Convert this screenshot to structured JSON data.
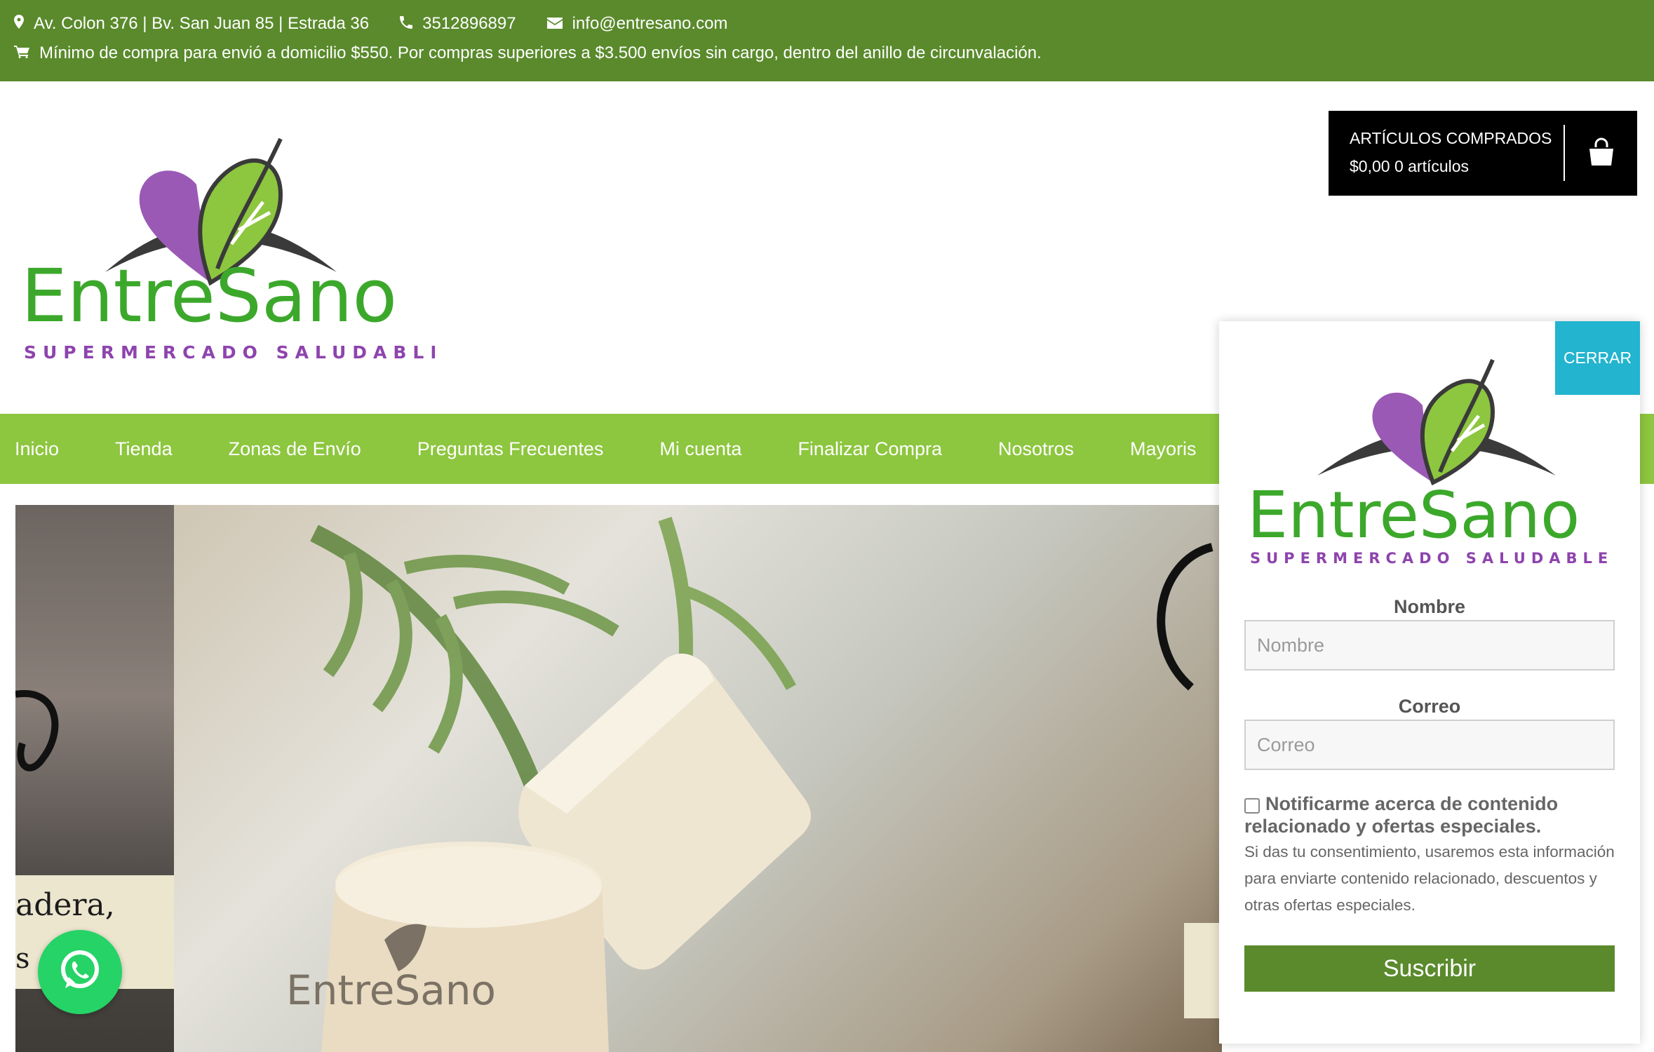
{
  "topbar": {
    "address": "Av. Colon 376 | Bv. San Juan 85 | Estrada 36",
    "phone": "3512896897",
    "email": "info@entresano.com",
    "notice": "Mínimo de compra para envió a domicilio $550. Por compras superiores a $3.500 envíos sin cargo, dentro del anillo de circunvalación."
  },
  "logo": {
    "brand_entre": "Entre",
    "brand_s": "S",
    "brand_ano": "ano",
    "tagline": "SUPERMERCADO SALUDABLE"
  },
  "cart": {
    "title": "ARTÍCULOS COMPRADOS",
    "summary": "$0,00 0 artículos"
  },
  "nav": {
    "items": [
      {
        "label": "Inicio"
      },
      {
        "label": "Tienda"
      },
      {
        "label": "Zonas de Envío"
      },
      {
        "label": "Preguntas Frecuentes"
      },
      {
        "label": "Mi cuenta"
      },
      {
        "label": "Finalizar Compra"
      },
      {
        "label": "Nosotros"
      },
      {
        "label": "Mayoris"
      }
    ]
  },
  "hero": {
    "left_text1": "adera,",
    "left_text2": "s"
  },
  "popup": {
    "close_label": "CERRAR",
    "name_label": "Nombre",
    "name_placeholder": "Nombre",
    "email_label": "Correo",
    "email_placeholder": "Correo",
    "consent_title": "Notificarme acerca de contenido relacionado y ofertas especiales.",
    "consent_text": "Si das tu consentimiento, usaremos esta información para enviarte contenido relacionado, descuentos y otras ofertas especiales.",
    "submit_label": "Suscribir"
  },
  "colors": {
    "topbar": "#5a8a2c",
    "nav": "#8dc63f",
    "close": "#23b4cf",
    "submit": "#5a8a2c",
    "whatsapp": "#25d366"
  },
  "icons": [
    "map-marker-icon",
    "phone-icon",
    "envelope-icon",
    "cart-icon",
    "shopping-bag-icon",
    "whatsapp-icon"
  ]
}
